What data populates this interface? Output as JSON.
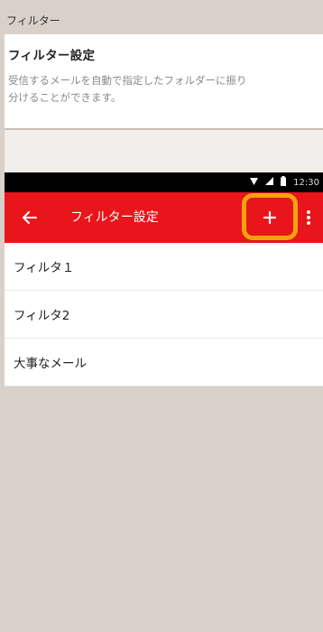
{
  "section_header": "フィルター",
  "settings": {
    "title": "フィルター設定",
    "description_line1": "受信するメールを自動で指定したフォルダーに振り",
    "description_line2": "分けることができます。"
  },
  "status_bar": {
    "time": "12:30",
    "icons": [
      "wifi-icon",
      "signal-icon",
      "battery-icon"
    ]
  },
  "app_bar": {
    "title": "フィルター設定",
    "color": "#e8151a",
    "highlight_color": "#f2a20f"
  },
  "filters": [
    {
      "label": "フィルタ１"
    },
    {
      "label": "フィルタ2"
    },
    {
      "label": "大事なメール"
    }
  ]
}
